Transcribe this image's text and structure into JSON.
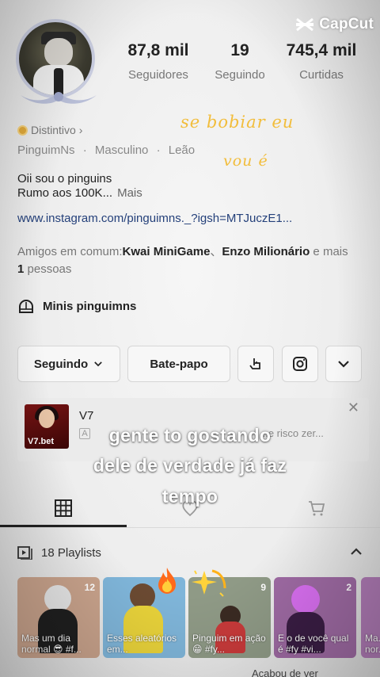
{
  "watermark": {
    "brand": "CapCut",
    "icon": "capcut-logo-icon"
  },
  "profile": {
    "avatar_icon": "avatar-penguin",
    "stats": [
      {
        "value": "87,8 mil",
        "label": "Seguidores"
      },
      {
        "value": "19",
        "label": "Seguindo"
      },
      {
        "value": "745,4 mil",
        "label": "Curtidas"
      }
    ],
    "badge_label": "Distintivo",
    "badge_chevron": "›",
    "handle": "PinguimNs",
    "gender": "Masculino",
    "sign": "Leão",
    "separator": "·",
    "bio_line1": "Oii sou o pinguins",
    "bio_line2": "Rumo aos 100K...",
    "bio_more": "Mais",
    "link": "www.instagram.com/pinguimns._?igsh=MTJuczE1...",
    "mutual_prefix": "Amigos em comum:",
    "mutual_friend1": "Kwai MiniGame",
    "mutual_sep": "、",
    "mutual_friend2": "Enzo Milionário",
    "mutual_suffix": " e mais",
    "mutual_count": "1",
    "mutual_unit": " pessoas",
    "collection_label": "Minis pinguimns"
  },
  "overlays": {
    "hand_line1": "se bobiar eu",
    "hand_line2": "vou é",
    "caption_line1": "gente to gostando",
    "caption_line2": "dele de verdade já faz",
    "caption_line3": "tempo"
  },
  "actions": {
    "following_label": "Seguindo",
    "chat_label": "Bate-papo"
  },
  "ad": {
    "title": "V7",
    "thumb_label": "V7.bet",
    "tag": "A",
    "desc": "...e risco zer..."
  },
  "tabs": [
    "videos-grid-icon",
    "liked-heart-icon",
    "shop-cart-icon"
  ],
  "playlists": {
    "header": "18 Playlists",
    "items": [
      {
        "title": "Mas um dia normal 😎 #f...",
        "count": "12",
        "bg": "#c9a38c"
      },
      {
        "title": "Esses aleatórios em...",
        "count": "",
        "bg": "#7fb5d9"
      },
      {
        "title": "Pinguim em ação 😁 #fy...",
        "count": "9",
        "bg": "#8f9a86"
      },
      {
        "title": "E o de você qual é #fy #vi...",
        "count": "2",
        "bg": "#9e6aa3"
      },
      {
        "title": "Ma... nor...",
        "count": "",
        "bg": "#b07bb6"
      }
    ]
  },
  "bottom_peek": "Acabou de ver"
}
